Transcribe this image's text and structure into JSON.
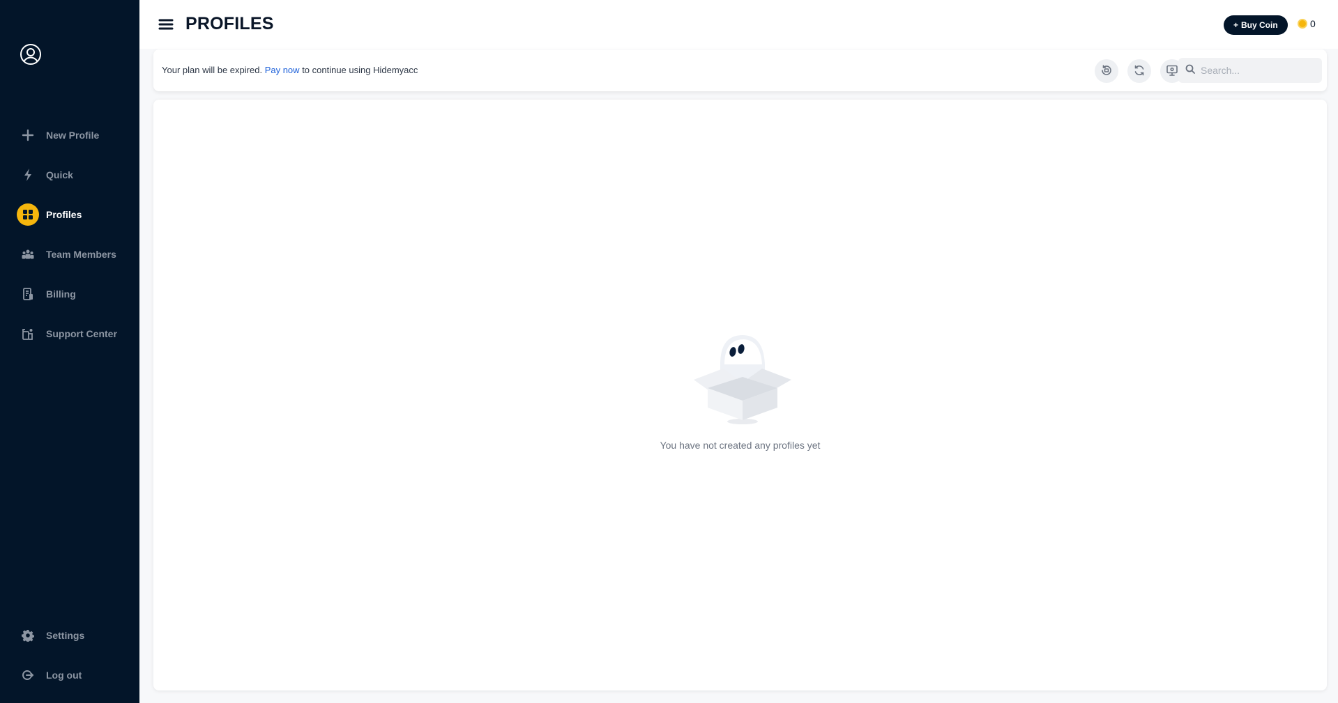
{
  "sidebar": {
    "items": [
      {
        "label": "New Profile",
        "icon": "plus-icon"
      },
      {
        "label": "Quick",
        "icon": "lightning-icon"
      },
      {
        "label": "Profiles",
        "icon": "grid-icon",
        "active": true
      },
      {
        "label": "Team Members",
        "icon": "team-icon"
      },
      {
        "label": "Billing",
        "icon": "billing-icon"
      },
      {
        "label": "Support Center",
        "icon": "support-icon"
      }
    ],
    "bottom_items": [
      {
        "label": "Settings",
        "icon": "gear-icon"
      },
      {
        "label": "Log out",
        "icon": "logout-icon"
      }
    ]
  },
  "header": {
    "title": "PROFILES",
    "buy_coin_label": "Buy Coin",
    "coin_balance": "0"
  },
  "notice": {
    "prefix": "Your plan will be expired.",
    "link": "Pay now",
    "suffix": "to continue using Hidemyacc"
  },
  "search": {
    "placeholder": "Search..."
  },
  "empty_state": {
    "message": "You have not created any profiles yet"
  },
  "colors": {
    "sidebar_bg": "#031529",
    "accent": "#f6b60d",
    "link": "#1b5fd9"
  }
}
